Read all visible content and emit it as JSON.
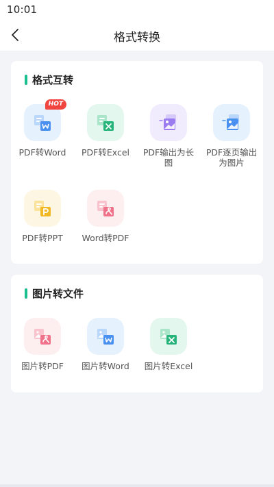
{
  "status_bar": {
    "time": "10:01"
  },
  "header": {
    "title": "格式转换"
  },
  "sections": [
    {
      "title": "格式互转",
      "items": [
        {
          "label": "PDF转Word",
          "badge": "HOT",
          "icon": "pdf-to-word-icon",
          "tile_color": "#e6f1fe",
          "accent": "#4a90f0"
        },
        {
          "label": "PDF转Excel",
          "icon": "pdf-to-excel-icon",
          "tile_color": "#e4f7ef",
          "accent": "#27b47a"
        },
        {
          "label": "PDF输出为长图",
          "icon": "pdf-to-long-image-icon",
          "tile_color": "#f1ecfd",
          "accent": "#9a7cf0"
        },
        {
          "label": "PDF逐页输出为图片",
          "icon": "pdf-pages-to-images-icon",
          "tile_color": "#e6f1fe",
          "accent": "#4a90f0"
        },
        {
          "label": "PDF转PPT",
          "icon": "pdf-to-ppt-icon",
          "tile_color": "#fdf6e2",
          "accent": "#f2b824"
        },
        {
          "label": "Word转PDF",
          "icon": "word-to-pdf-icon",
          "tile_color": "#fdeef0",
          "accent": "#f0728a"
        }
      ]
    },
    {
      "title": "图片转文件",
      "items": [
        {
          "label": "图片转PDF",
          "icon": "image-to-pdf-icon",
          "tile_color": "#fdeef0",
          "accent": "#f0728a"
        },
        {
          "label": "图片转Word",
          "icon": "image-to-word-icon",
          "tile_color": "#e6f1fe",
          "accent": "#4a90f0"
        },
        {
          "label": "图片转Excel",
          "icon": "image-to-excel-icon",
          "tile_color": "#e4f7ef",
          "accent": "#27b47a"
        }
      ]
    }
  ]
}
